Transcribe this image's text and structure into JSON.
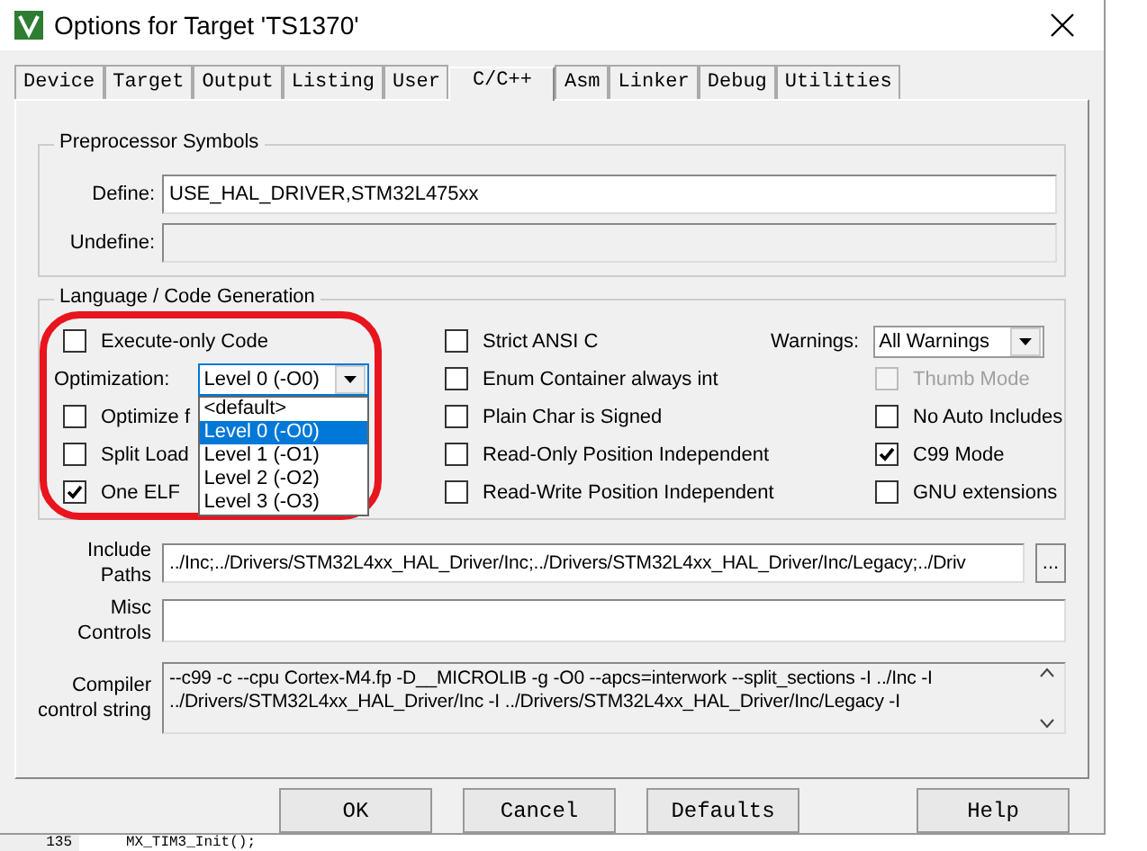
{
  "window": {
    "title": "Options for Target 'TS1370'"
  },
  "tabs": [
    {
      "label": "Device",
      "selected": false
    },
    {
      "label": "Target",
      "selected": false
    },
    {
      "label": "Output",
      "selected": false
    },
    {
      "label": "Listing",
      "selected": false
    },
    {
      "label": "User",
      "selected": false
    },
    {
      "label": "C/C++",
      "selected": true
    },
    {
      "label": "Asm",
      "selected": false
    },
    {
      "label": "Linker",
      "selected": false
    },
    {
      "label": "Debug",
      "selected": false
    },
    {
      "label": "Utilities",
      "selected": false
    }
  ],
  "preprocessor": {
    "title": "Preprocessor Symbols",
    "fields": [
      {
        "label": "Define:",
        "value": "USE_HAL_DRIVER,STM32L475xx",
        "disabled": false
      },
      {
        "label": "Undefine:",
        "disabled": true
      }
    ]
  },
  "language": {
    "title": "Language / Code Generation",
    "columns": [
      [
        {
          "kind": "checkbox",
          "label": "Execute-only Code",
          "checked": false,
          "disabled": false
        },
        {
          "kind": "select",
          "label": "Optimization:",
          "value": "Level 0 (-O0)",
          "expanded": true,
          "options": [
            {
              "label": "<default>",
              "selected": false
            },
            {
              "label": "Level 0 (-O0)",
              "selected": true
            },
            {
              "label": "Level 1 (-O1)",
              "selected": false
            },
            {
              "label": "Level 2 (-O2)",
              "selected": false
            },
            {
              "label": "Level 3 (-O3)",
              "selected": false
            }
          ]
        },
        {
          "kind": "checkbox",
          "label": "Optimize f",
          "checked": false,
          "disabled": false
        },
        {
          "kind": "checkbox",
          "label": "Split Load",
          "checked": false,
          "disabled": false
        },
        {
          "kind": "checkbox",
          "label": "One ELF",
          "checked": true,
          "disabled": false
        }
      ],
      [
        {
          "kind": "checkbox",
          "label": "Strict ANSI C",
          "checked": false,
          "disabled": false
        },
        {
          "kind": "checkbox",
          "label": "Enum Container always int",
          "checked": false,
          "disabled": false
        },
        {
          "kind": "checkbox",
          "label": "Plain Char is Signed",
          "checked": false,
          "disabled": false
        },
        {
          "kind": "checkbox",
          "label": "Read-Only Position Independent",
          "checked": false,
          "disabled": false
        },
        {
          "kind": "checkbox",
          "label": "Read-Write Position Independent",
          "checked": false,
          "disabled": false
        }
      ],
      [
        {
          "kind": "select",
          "label": "Warnings:",
          "value": "All Warnings",
          "expanded": false
        },
        {
          "kind": "checkbox",
          "label": "Thumb Mode",
          "checked": false,
          "disabled": true
        },
        {
          "kind": "checkbox",
          "label": "No Auto Includes",
          "checked": false,
          "disabled": false
        },
        {
          "kind": "checkbox",
          "label": "C99 Mode",
          "checked": true,
          "disabled": false
        },
        {
          "kind": "checkbox",
          "label": "GNU extensions",
          "checked": false,
          "disabled": false
        }
      ]
    ]
  },
  "include_paths": {
    "label": "Include Paths",
    "value": "../Inc;../Drivers/STM32L4xx_HAL_Driver/Inc;../Drivers/STM32L4xx_HAL_Driver/Inc/Legacy;../Driv",
    "browse": "..."
  },
  "misc_controls": {
    "label": "Misc Controls"
  },
  "compiler_control": {
    "label": "Compiler control string",
    "lines": [
      "--c99 -c --cpu Cortex-M4.fp -D__MICROLIB -g -O0 --apcs=interwork --split_sections -I ../Inc -I",
      "../Drivers/STM32L4xx_HAL_Driver/Inc -I ../Drivers/STM32L4xx_HAL_Driver/Inc/Legacy -I"
    ]
  },
  "buttons": [
    "OK",
    "Cancel",
    "Defaults",
    "Help"
  ],
  "editor": {
    "line_number": "135",
    "code": "MX_TIM3_Init();"
  }
}
